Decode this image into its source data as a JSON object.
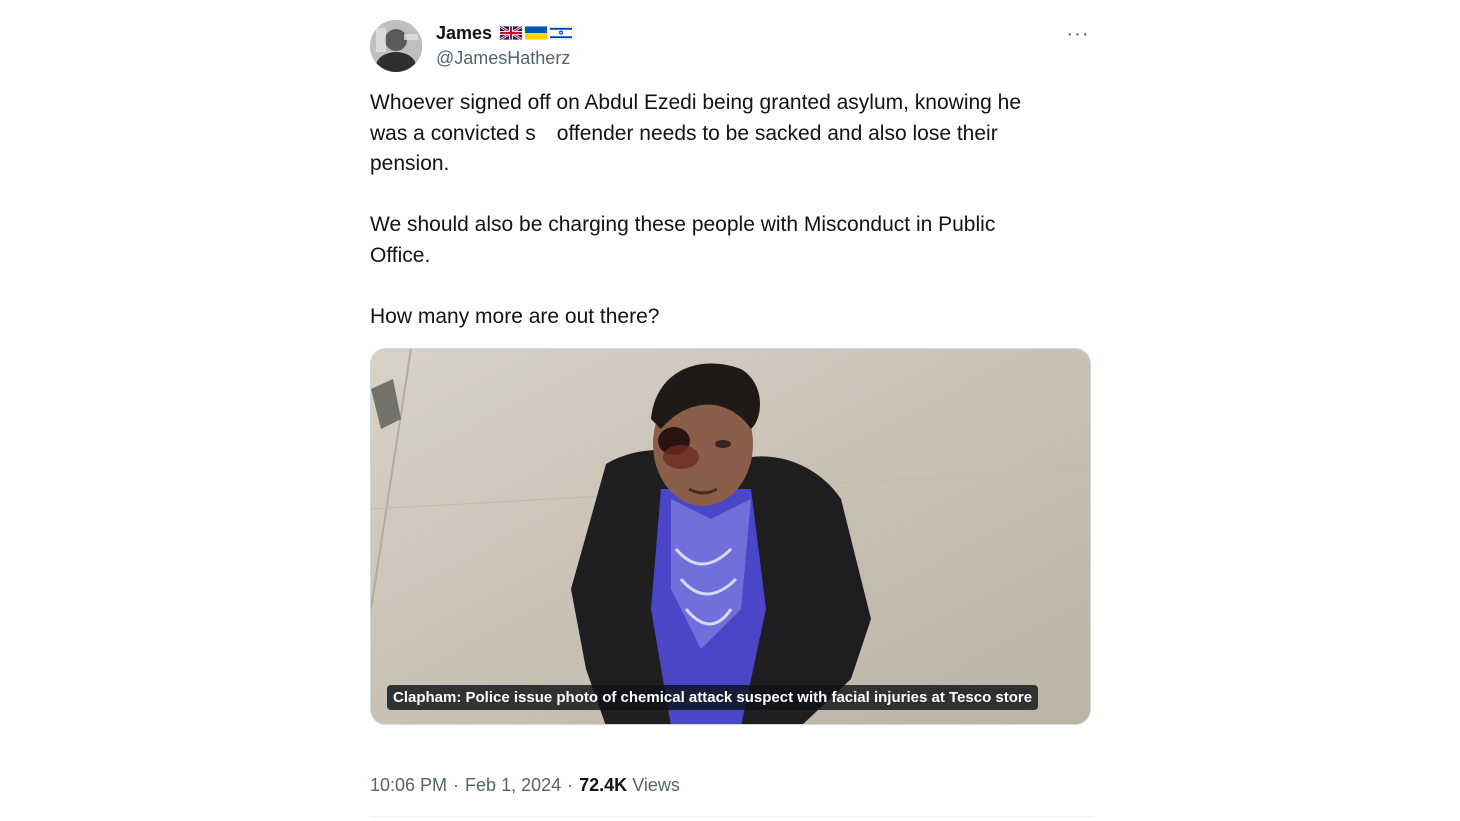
{
  "author": {
    "display_name": "James",
    "handle": "@JamesHatherz",
    "flags": [
      "uk-flag-icon",
      "ukraine-flag-icon",
      "israel-flag-icon"
    ]
  },
  "more_label": "···",
  "body": {
    "p1_line1": "Whoever signed off on Abdul Ezedi being granted asylum, knowing he",
    "p1_line2": "was a convicted s     offender needs to be sacked and also lose their",
    "p1_line3": "pension.",
    "p2_line1": "We should also be charging these people with Misconduct in Public",
    "p2_line2": "Office.",
    "p3_line1": "How many more are out there?"
  },
  "media": {
    "caption": "Clapham: Police issue photo of chemical attack suspect with facial injuries at Tesco store"
  },
  "meta": {
    "time": "10:06 PM",
    "separator": "·",
    "date": "Feb 1, 2024",
    "views_count": "72.4K",
    "views_label": "Views"
  },
  "colors": {
    "text": "#0f1419",
    "secondary": "#536471",
    "caption_bg": "#0f1419"
  }
}
